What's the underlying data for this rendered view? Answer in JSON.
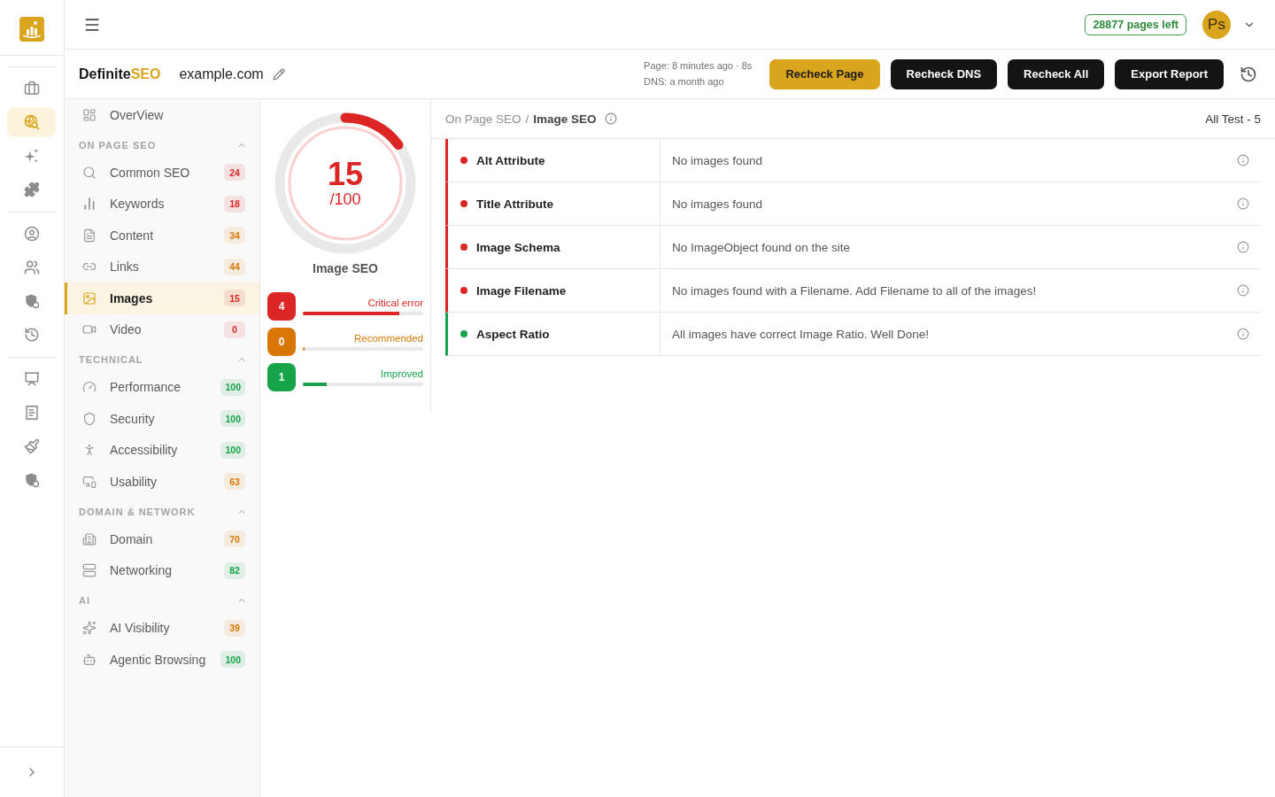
{
  "rail": {
    "groups": [
      {
        "items": [
          {
            "selected": false
          },
          {
            "selected": true
          },
          {
            "selected": false
          },
          {
            "selected": false
          }
        ]
      },
      {
        "items": [
          {
            "selected": false
          },
          {
            "selected": false
          },
          {
            "selected": false
          },
          {
            "selected": false
          }
        ]
      },
      {
        "items": [
          {
            "selected": false
          },
          {
            "selected": false
          },
          {
            "selected": false
          },
          {
            "selected": false
          }
        ]
      }
    ]
  },
  "topbar": {
    "pages_left": "28877 pages left",
    "avatar": "Ps"
  },
  "header": {
    "brand_main": "Definite",
    "brand_accent": "SEO",
    "domain": "example.com",
    "page_checked": "Page: 8 minutes ago · 8s",
    "dns_checked": "DNS: a month ago",
    "buttons": [
      {
        "label": "Recheck Page",
        "kind": "primary"
      },
      {
        "label": "Recheck DNS",
        "kind": "dark"
      },
      {
        "label": "Recheck All",
        "kind": "dark"
      },
      {
        "label": "Export Report",
        "kind": "dark"
      }
    ]
  },
  "sidebar": {
    "overview": {
      "label": "OverView",
      "selected": false
    },
    "sections": [
      {
        "title": "ON PAGE SEO",
        "expanded": true,
        "items": [
          {
            "label": "Common SEO",
            "selected": false,
            "badge": {
              "text": "24",
              "color": "#dc2626"
            }
          },
          {
            "label": "Keywords",
            "selected": false,
            "badge": {
              "text": "18",
              "color": "#dc2626"
            }
          },
          {
            "label": "Content",
            "selected": false,
            "badge": {
              "text": "34",
              "color": "#d97706"
            }
          },
          {
            "label": "Links",
            "selected": false,
            "badge": {
              "text": "44",
              "color": "#d97706"
            }
          },
          {
            "label": "Images",
            "selected": true,
            "badge": {
              "text": "15",
              "color": "#dc2626"
            }
          },
          {
            "label": "Video",
            "selected": false,
            "badge": {
              "text": "0",
              "color": "#dc2626"
            }
          }
        ]
      },
      {
        "title": "TECHNICAL",
        "expanded": true,
        "items": [
          {
            "label": "Performance",
            "selected": false,
            "badge": {
              "text": "100",
              "color": "#16a34a"
            }
          },
          {
            "label": "Security",
            "selected": false,
            "badge": {
              "text": "100",
              "color": "#16a34a"
            }
          },
          {
            "label": "Accessibility",
            "selected": false,
            "badge": {
              "text": "100",
              "color": "#16a34a"
            }
          },
          {
            "label": "Usability",
            "selected": false,
            "badge": {
              "text": "63",
              "color": "#d97706"
            }
          }
        ]
      },
      {
        "title": "DOMAIN & NETWORK",
        "expanded": true,
        "items": [
          {
            "label": "Domain",
            "selected": false,
            "badge": {
              "text": "70",
              "color": "#d97706"
            }
          },
          {
            "label": "Networking",
            "selected": false,
            "badge": {
              "text": "82",
              "color": "#16a34a"
            }
          }
        ]
      },
      {
        "title": "AI",
        "expanded": true,
        "items": [
          {
            "label": "AI Visibility",
            "selected": false,
            "badge": {
              "text": "39",
              "color": "#d97706"
            }
          },
          {
            "label": "Agentic Browsing",
            "selected": false,
            "badge": {
              "text": "100",
              "color": "#16a34a"
            }
          }
        ]
      }
    ]
  },
  "score": {
    "value": "15",
    "out_of": "/100",
    "level": 0.15,
    "title": "Image SEO",
    "stats": [
      {
        "count": "4",
        "label": "Critical error",
        "level": 0.8,
        "color": "#dc2626"
      },
      {
        "count": "0",
        "label": "Recommended",
        "level": 0,
        "color": "#d97706"
      },
      {
        "count": "1",
        "label": "Improved",
        "level": 0.2,
        "color": "#16a34a"
      }
    ]
  },
  "main": {
    "breadcrumb": {
      "parent": "On Page SEO",
      "separator": "/",
      "current": "Image SEO"
    },
    "total": "All Test - 5",
    "tests": [
      {
        "name": "Alt Attribute",
        "result": "No images found",
        "color": "#dc2626"
      },
      {
        "name": "Title Attribute",
        "result": "No images found",
        "color": "#dc2626"
      },
      {
        "name": "Image Schema",
        "result": "No ImageObject found on the site",
        "color": "#dc2626"
      },
      {
        "name": "Image Filename",
        "result": "No images found with a Filename. Add Filename to all of the images!",
        "color": "#dc2626"
      },
      {
        "name": "Aspect Ratio",
        "result": "All images have correct Image Ratio. Well Done!",
        "color": "#16a34a"
      }
    ]
  }
}
